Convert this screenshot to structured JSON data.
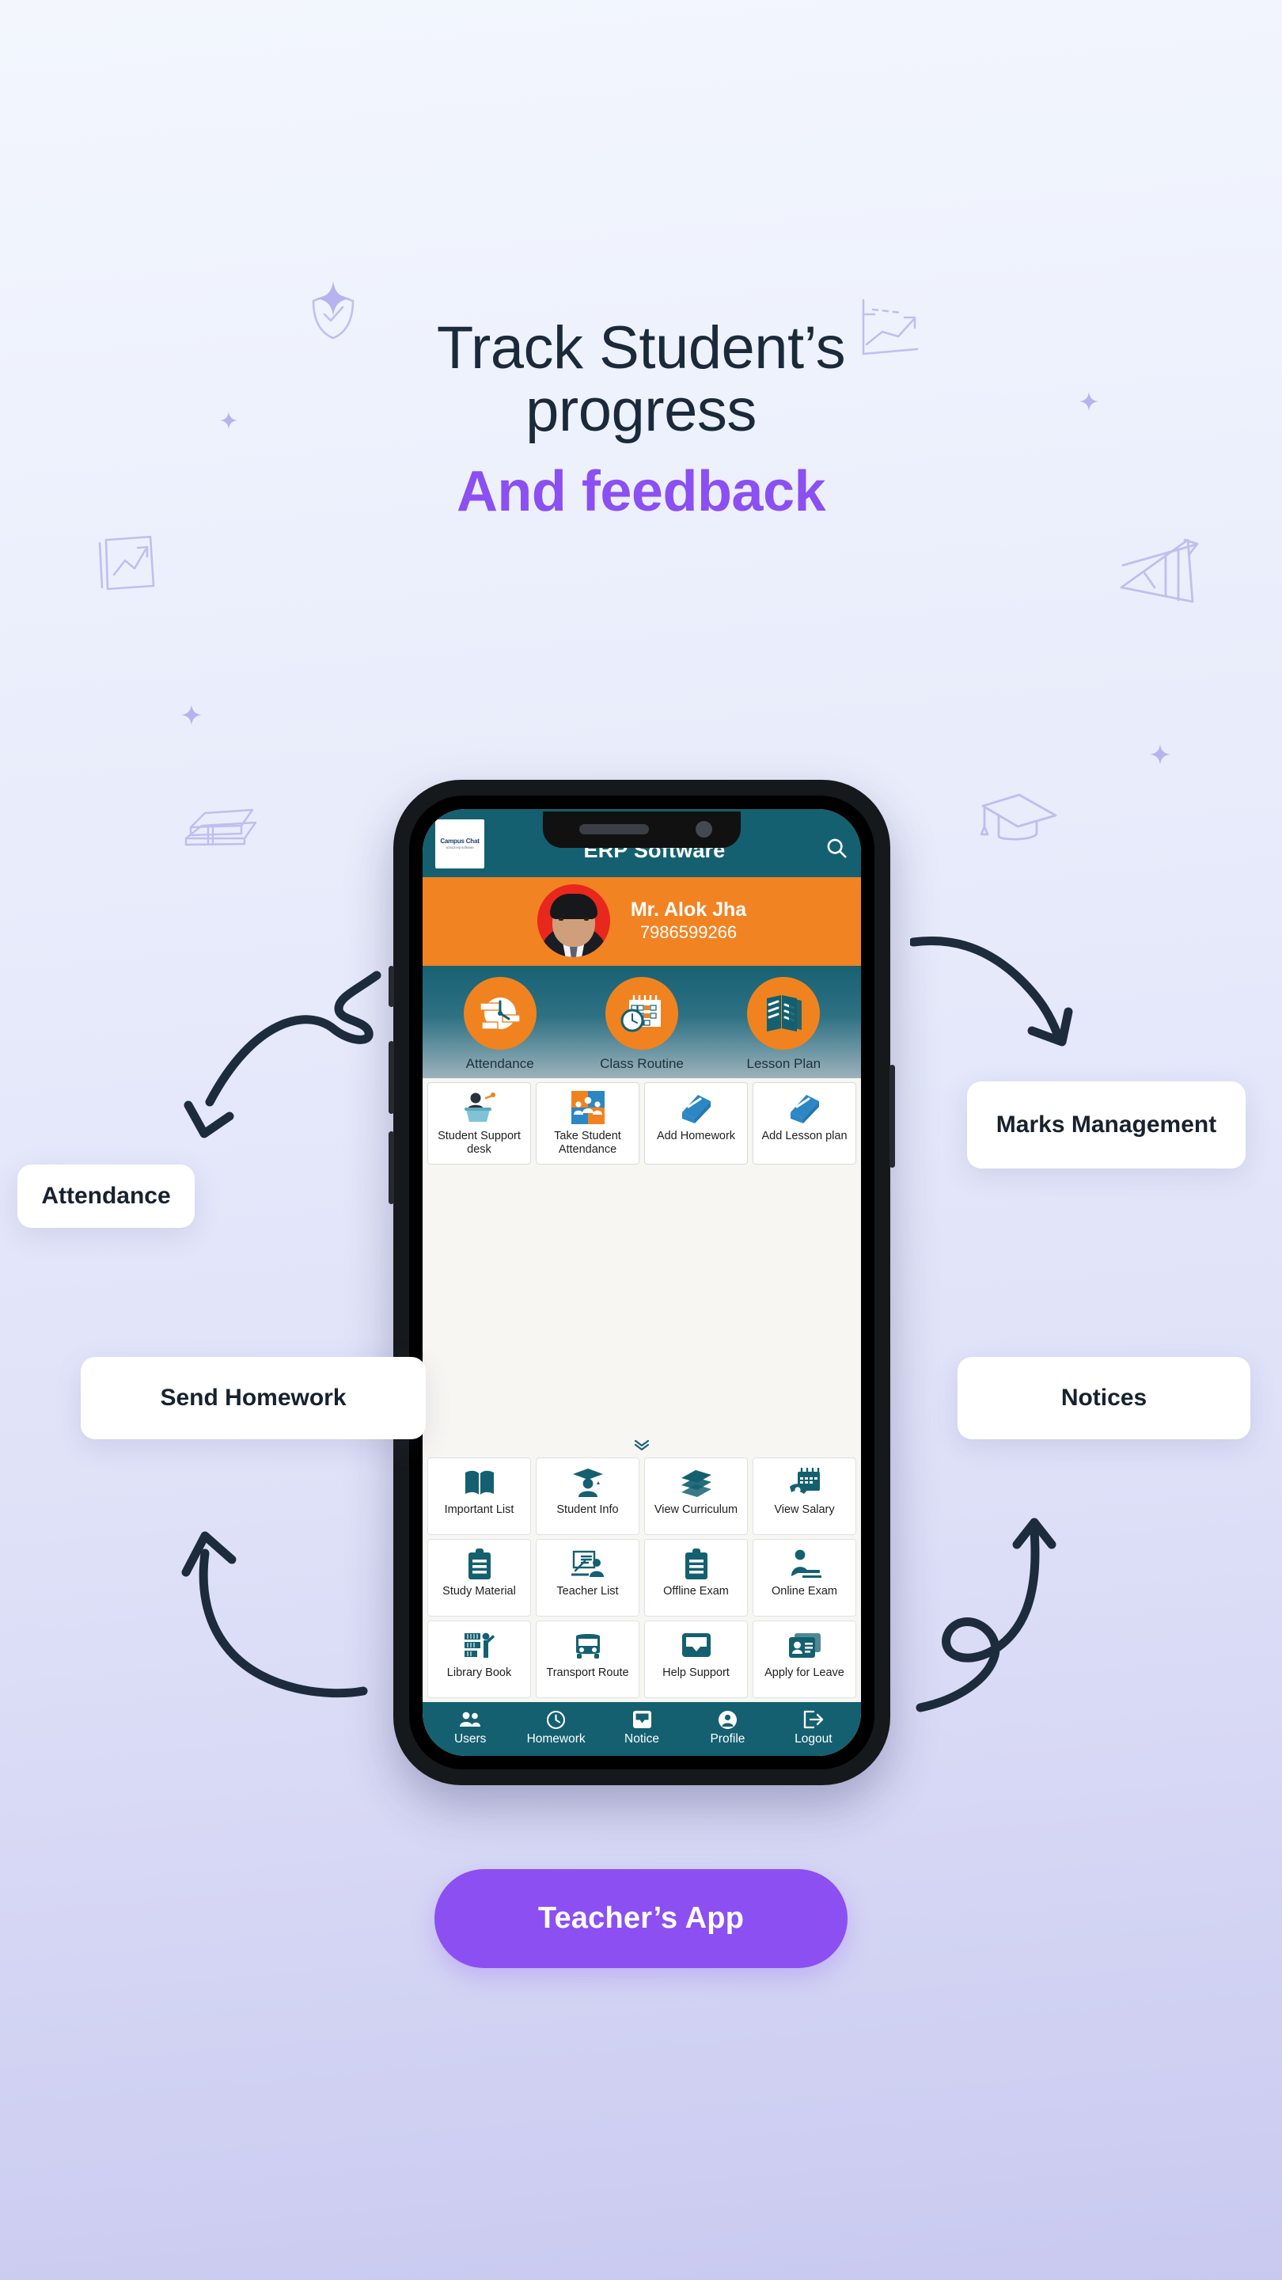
{
  "hero": {
    "line1": "Track Student’s",
    "line2": "progress",
    "line3": "And feedback",
    "accent_color": "#8b4ff2",
    "heading_color": "#1b2a3a"
  },
  "phone_app": {
    "header": {
      "logo_text": "Campus Chat",
      "logo_sub": "school erp software",
      "title": "ERP Software",
      "search_icon": "search-icon",
      "background_color": "#146070"
    },
    "profile": {
      "name": "Mr. Alok Jha",
      "phone": "7986599266",
      "background_color": "#f28322",
      "avatar_icon": "avatar"
    },
    "feature_circles": [
      {
        "label": "Attendance",
        "icon": "clock-attendance-icon"
      },
      {
        "label": "Class Routine",
        "icon": "calendar-clock-icon"
      },
      {
        "label": "Lesson Plan",
        "icon": "books-icon"
      }
    ],
    "quick_actions": [
      {
        "label": "Student Support desk",
        "icon": "podium-speaker-icon"
      },
      {
        "label": "Take Student Attendance",
        "icon": "students-group-icon"
      },
      {
        "label": "Add Homework",
        "icon": "book-icon"
      },
      {
        "label": "Add Lesson plan",
        "icon": "book-icon"
      }
    ],
    "expand_indicator": "chevron-double-down-icon",
    "menu_grid": [
      {
        "label": "Important List",
        "icon": "open-book-icon"
      },
      {
        "label": "Student Info",
        "icon": "graduate-icon"
      },
      {
        "label": "View Curriculum",
        "icon": "book-stack-icon"
      },
      {
        "label": "View Salary",
        "icon": "salary-calendar-icon"
      },
      {
        "label": "Study Material",
        "icon": "clipboard-icon"
      },
      {
        "label": "Teacher List",
        "icon": "teacher-board-icon"
      },
      {
        "label": "Offline Exam",
        "icon": "clipboard-icon"
      },
      {
        "label": "Online Exam",
        "icon": "person-laptop-icon"
      },
      {
        "label": "Library Book",
        "icon": "library-shelf-icon"
      },
      {
        "label": "Transport Route",
        "icon": "bus-icon"
      },
      {
        "label": "Help Support",
        "icon": "chat-box-icon"
      },
      {
        "label": "Apply for Leave",
        "icon": "id-card-icon"
      }
    ],
    "bottom_nav": [
      {
        "label": "Users",
        "icon": "users-icon"
      },
      {
        "label": "Homework",
        "icon": "clock-icon"
      },
      {
        "label": "Notice",
        "icon": "inbox-icon"
      },
      {
        "label": "Profile",
        "icon": "person-icon"
      },
      {
        "label": "Logout",
        "icon": "logout-icon"
      }
    ]
  },
  "callouts": {
    "attendance": "Attendance",
    "marks_management": "Marks Management",
    "send_homework": "Send Homework",
    "notices": "Notices"
  },
  "cta": {
    "label": "Teacher’s App",
    "background_color": "#8b4ff2"
  },
  "decorations": [
    "shield-check-icon",
    "line-chart-arrow-icon",
    "photo-chart-book-icon",
    "book-stack-doodle-icon",
    "growth-chart-arrow-icon",
    "graduation-cap-doodle-icon",
    "sparkle-icon",
    "curved-arrow-icon"
  ]
}
